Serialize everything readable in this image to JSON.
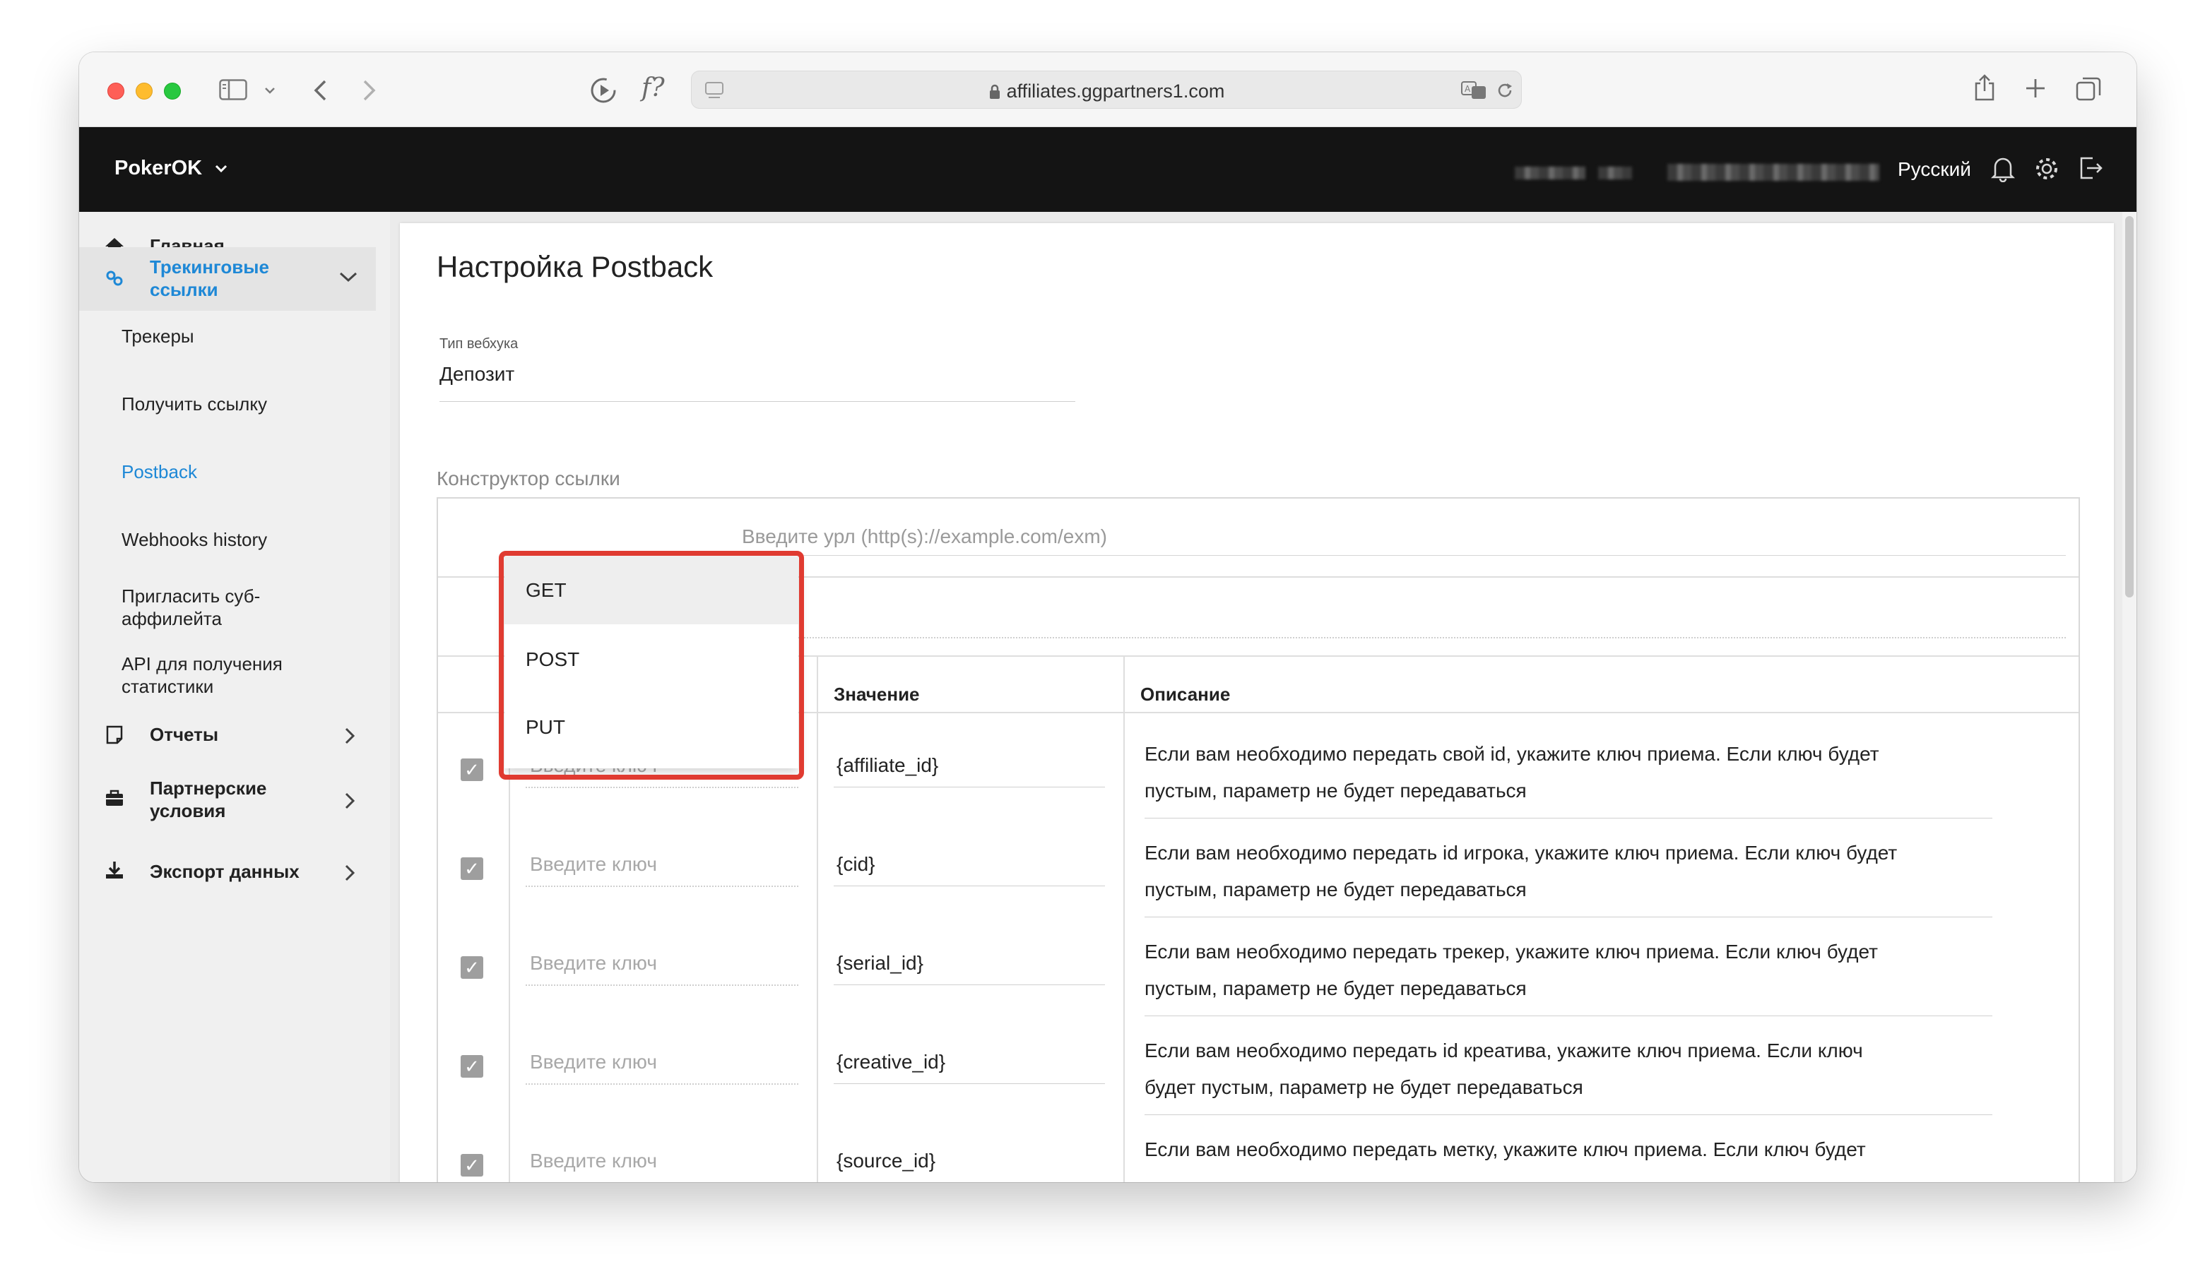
{
  "browser": {
    "url": "affiliates.ggpartners1.com",
    "function_label": "f?"
  },
  "header": {
    "brand": "PokerOK",
    "language": "Русский"
  },
  "sidebar": {
    "items": [
      {
        "label": "Главная"
      },
      {
        "label": "Трекинговые ссылки"
      },
      {
        "label": "Отчеты"
      },
      {
        "label": "Партнерские условия"
      },
      {
        "label": "Экспорт данных"
      }
    ],
    "sub_items": [
      {
        "label": "Трекеры"
      },
      {
        "label": "Получить ссылку"
      },
      {
        "label": "Postback"
      },
      {
        "label": "Webhooks history"
      },
      {
        "label": "Пригласить суб-аффилейта"
      },
      {
        "label": "API для получения статистики"
      }
    ]
  },
  "page": {
    "title": "Настройка Postback",
    "webhook_type_label": "Тип вебхука",
    "webhook_type_value": "Депозит",
    "constructor_label": "Конструктор ссылки",
    "url_placeholder": "Введите урл (http(s)://example.com/exm)"
  },
  "table": {
    "headers": {
      "value": "Значение",
      "description": "Описание"
    },
    "key_placeholder": "Введите ключ",
    "rows": [
      {
        "value": "{affiliate_id}",
        "desc1": "Если вам необходимо передать свой id, укажите ключ приема. Если ключ будет",
        "desc2": "пустым, параметр не будет передаваться"
      },
      {
        "value": "{cid}",
        "desc1": "Если вам необходимо передать id игрока, укажите ключ приема. Если ключ будет",
        "desc2": "пустым, параметр не будет передаваться"
      },
      {
        "value": "{serial_id}",
        "desc1": "Если вам необходимо передать трекер, укажите ключ приема. Если ключ будет",
        "desc2": "пустым, параметр не будет передаваться"
      },
      {
        "value": "{creative_id}",
        "desc1": "Если вам необходимо передать id креатива, укажите ключ приема. Если ключ",
        "desc2": "будет пустым, параметр не будет передаваться"
      },
      {
        "value": "{source_id}",
        "desc1": "Если вам необходимо передать метку, укажите ключ приема. Если ключ будет",
        "desc2": ""
      }
    ]
  },
  "method_dropdown": {
    "options": [
      "GET",
      "POST",
      "PUT"
    ],
    "selected": "GET"
  },
  "colors": {
    "accent": "#1e88d6",
    "highlight": "#e03b31",
    "header_bg": "#141414"
  }
}
